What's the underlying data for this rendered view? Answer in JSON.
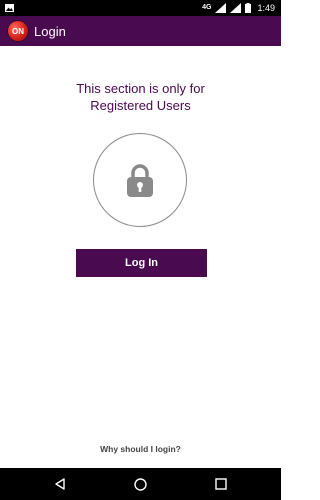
{
  "status_bar": {
    "network": "4G",
    "time": "1:49",
    "icons": [
      "image-notification-icon",
      "wifi-icon",
      "signal-icon",
      "battery-icon"
    ]
  },
  "app_bar": {
    "logo_text": "ON",
    "title": "Login"
  },
  "content": {
    "headline_line1": "This section is only for",
    "headline_line2": "Registered Users",
    "lock_icon": "lock-icon",
    "login_button": "Log In",
    "why_login": "Why should I login?"
  },
  "nav_bar": {
    "icons": [
      "back-icon",
      "home-icon",
      "recents-icon"
    ]
  },
  "colors": {
    "primary": "#4a0a4f",
    "lock_gray": "#8a8a8a",
    "background": "#ffffff"
  }
}
